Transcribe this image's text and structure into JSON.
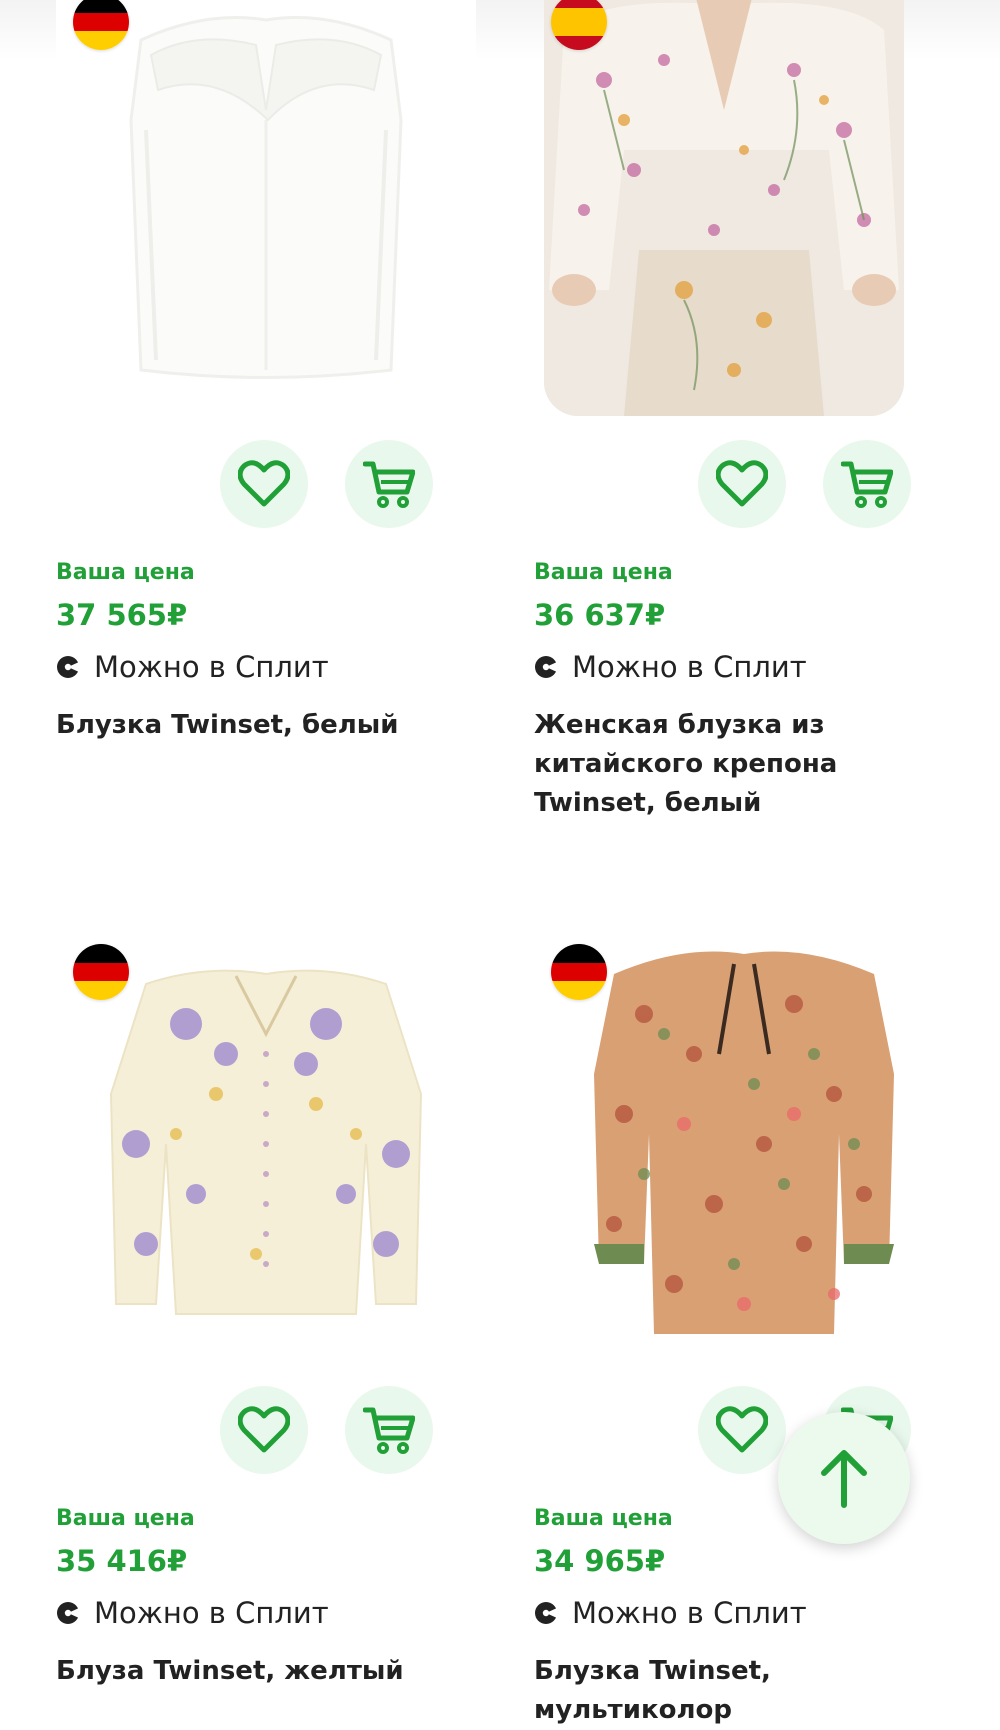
{
  "products": [
    {
      "price_label": "Ваша цена",
      "price": "37 565₽",
      "split_text": "Можно в Сплит",
      "title": "Блузка Twinset, белый",
      "flag": "germany-flag",
      "colors": {
        "flag": [
          "#000000",
          "#dd0000",
          "#ffce00"
        ]
      }
    },
    {
      "price_label": "Ваша цена",
      "price": "36 637₽",
      "split_text": "Можно в Сплит",
      "title": "Женская блузка из китайского крепона Twinset, белый",
      "flag": "spain-flag",
      "colors": {
        "flag": [
          "#c60b1e",
          "#ffc400",
          "#c60b1e"
        ]
      }
    },
    {
      "price_label": "Ваша цена",
      "price": "35 416₽",
      "split_text": "Можно в Сплит",
      "title": "Блуза Twinset, желтый",
      "flag": "germany-flag",
      "colors": {
        "flag": [
          "#000000",
          "#dd0000",
          "#ffce00"
        ]
      }
    },
    {
      "price_label": "Ваша цена",
      "price": "34 965₽",
      "split_text": "Можно в Сплит",
      "title": "Блузка Twinset, мультиколор",
      "flag": "germany-flag",
      "colors": {
        "flag": [
          "#000000",
          "#dd0000",
          "#ffce00"
        ]
      }
    }
  ],
  "icons": {
    "favorite": "heart-icon",
    "cart": "cart-icon",
    "split": "split-icon",
    "scroll_top": "arrow-up-icon"
  },
  "accent_color": "#21a038"
}
